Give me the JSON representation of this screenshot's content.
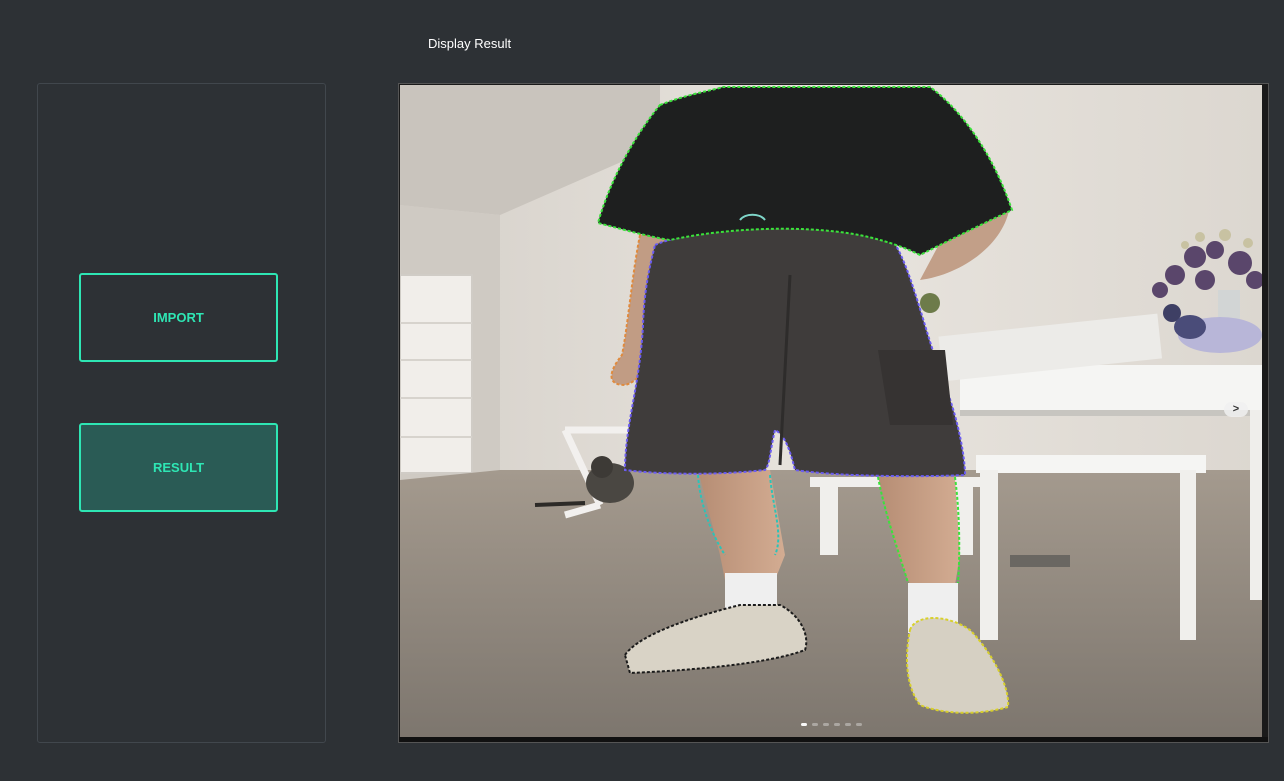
{
  "header": {
    "title": "Display Result"
  },
  "sidebar": {
    "import_label": "IMPORT",
    "result_label": "RESULT"
  },
  "viewer": {
    "next_label": ">",
    "slides": 6,
    "active_slide": 1
  },
  "colors": {
    "background": "#2d3135",
    "accent": "#2ee6b4",
    "result_fill": "#2a5b55"
  }
}
